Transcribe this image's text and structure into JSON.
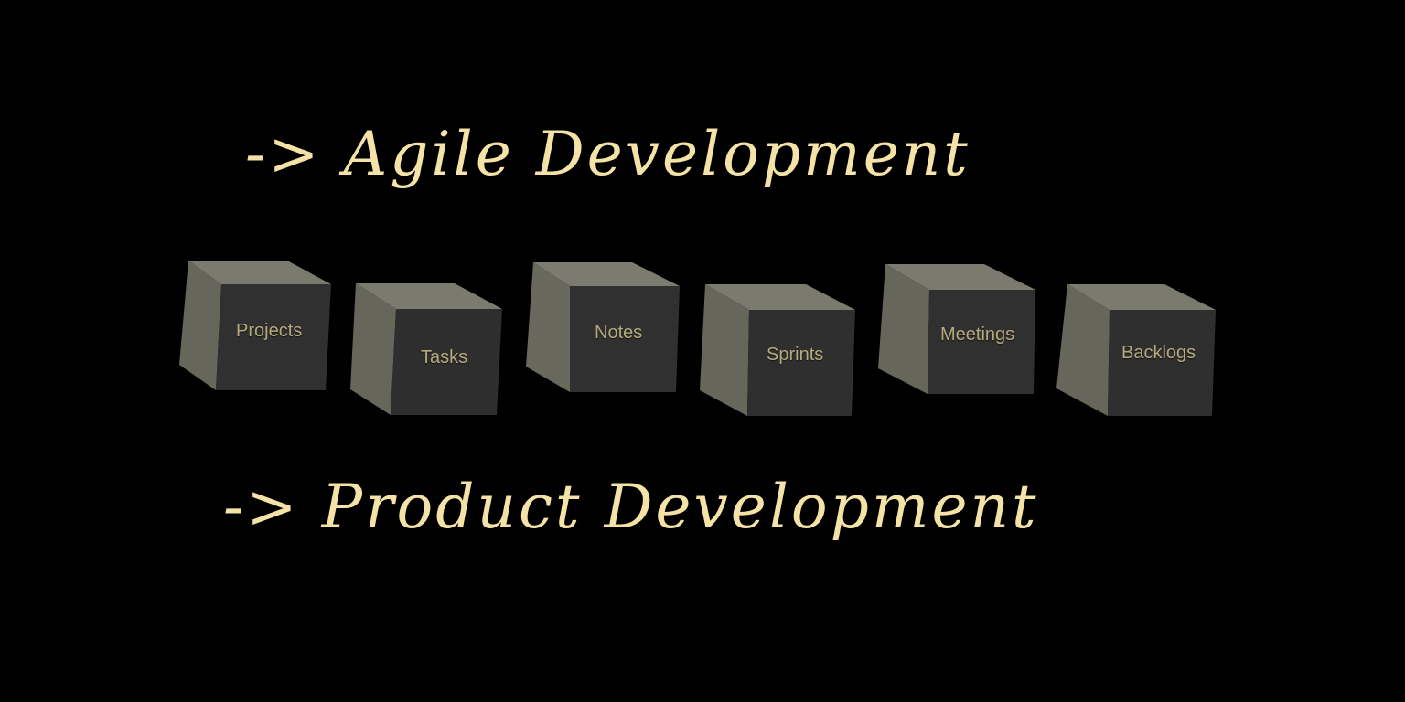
{
  "headings": {
    "top": "-> Agile Development",
    "bottom": "-> Product Development"
  },
  "cubes": [
    {
      "label": "Projects"
    },
    {
      "label": "Tasks"
    },
    {
      "label": "Notes"
    },
    {
      "label": "Sprints"
    },
    {
      "label": "Meetings"
    },
    {
      "label": "Backlogs"
    }
  ],
  "colors": {
    "background": "#000000",
    "heading_text": "#f4e2a6",
    "cube_label": "#b5aa7d",
    "cube_top": "#77776c",
    "cube_side": "#66665c",
    "cube_front": "#2f2f2f"
  }
}
